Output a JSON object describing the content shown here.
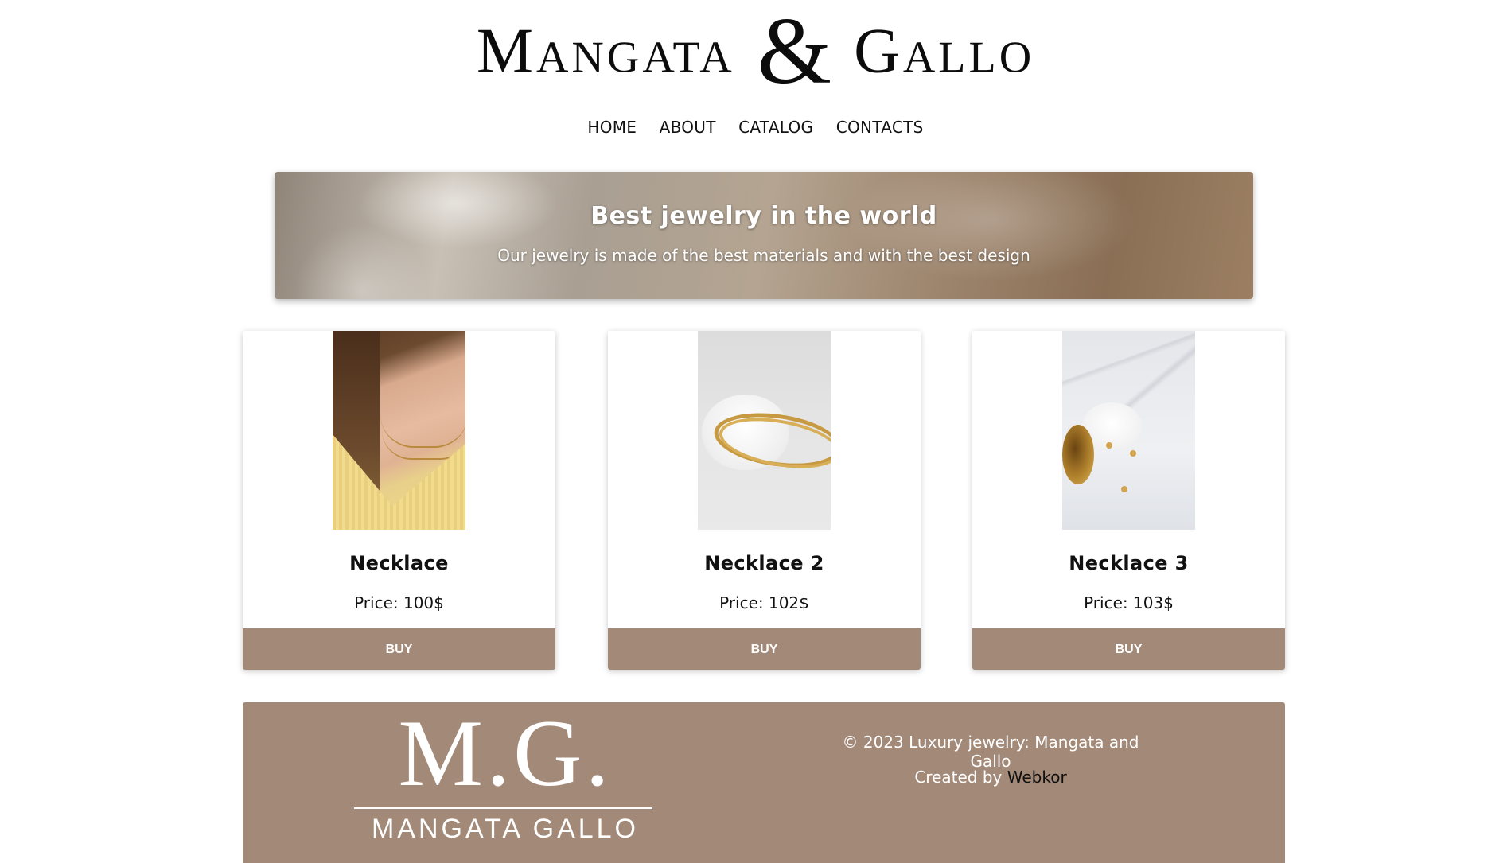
{
  "brand": {
    "logo_left": "Mangata",
    "logo_amp": "&",
    "logo_right": "Gallo"
  },
  "nav": {
    "items": [
      {
        "label": "HOME"
      },
      {
        "label": "ABOUT"
      },
      {
        "label": "CATALOG"
      },
      {
        "label": "CONTACTS"
      }
    ]
  },
  "banner": {
    "title": "Best jewelry in the world",
    "subtitle": "Our jewelry is made of the best materials and with the best design"
  },
  "products": [
    {
      "name": "Necklace",
      "price": "Price: 100$",
      "button": "BUY"
    },
    {
      "name": "Necklace 2",
      "price": "Price: 102$",
      "button": "BUY"
    },
    {
      "name": "Necklace 3",
      "price": "Price: 103$",
      "button": "BUY"
    }
  ],
  "footer": {
    "logo_mark": "M.G.",
    "logo_sub": "MANGATA GALLO",
    "copyright": "© 2023 Luxury jewelry: Mangata and Gallo",
    "credit_prefix": "Created by ",
    "credit_link": "Webkor"
  },
  "colors": {
    "accent": "#a38978",
    "text": "#111111",
    "background": "#ffffff"
  }
}
